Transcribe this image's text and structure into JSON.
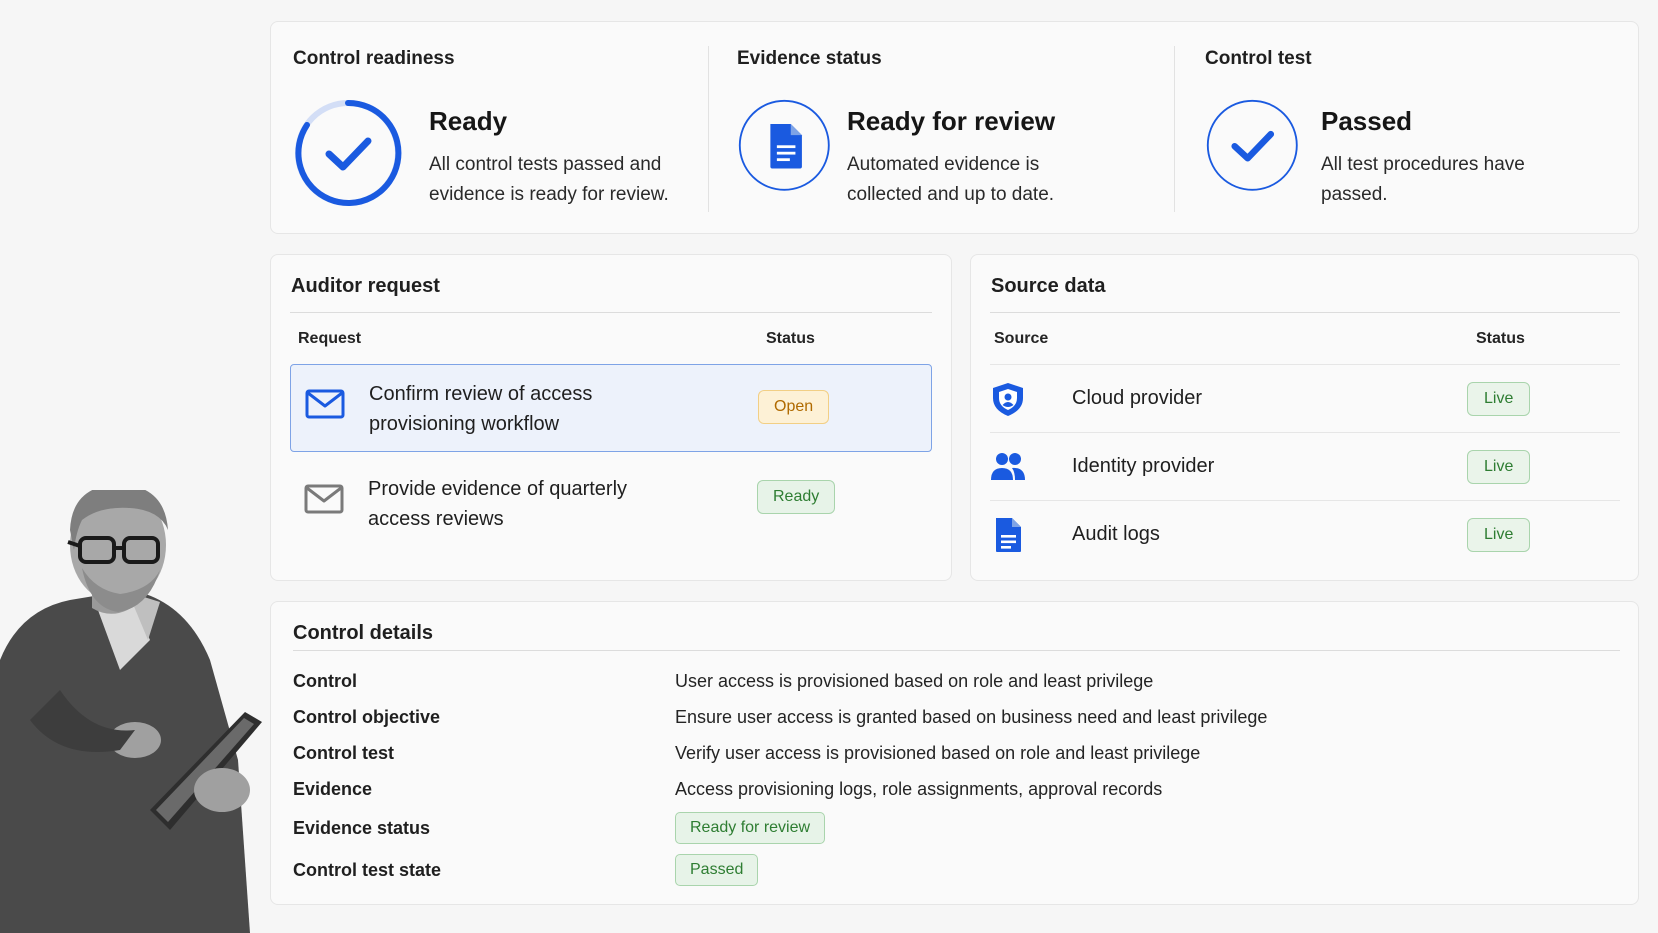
{
  "control_readiness": {
    "title": "Control readiness",
    "headline": "Ready",
    "description": "All control tests passed and evidence is ready for review.",
    "icon": "check-circle-icon"
  },
  "evidence_status": {
    "title": "Evidence status",
    "headline": "Ready for review",
    "description": "Automated evidence is collected and up to date.",
    "icon": "document-icon"
  },
  "control_test": {
    "title": "Control test",
    "headline": "Passed",
    "description": "All test procedures have passed.",
    "icon": "check-circle-icon"
  },
  "auditor_request": {
    "title": "Auditor request",
    "col_request": "Request",
    "col_status": "Status",
    "rows": [
      {
        "text": "Confirm review of access provisioning workflow",
        "status": "Open",
        "icon": "mail-icon"
      },
      {
        "text": "Provide evidence of quarterly access reviews",
        "status": "Ready",
        "icon": "mail-icon"
      }
    ]
  },
  "source_data": {
    "title": "Source data",
    "col_source": "Source",
    "col_status": "Status",
    "rows": [
      {
        "label": "Cloud provider",
        "status": "Live",
        "icon": "shield-icon"
      },
      {
        "label": "Identity provider",
        "status": "Live",
        "icon": "users-icon"
      },
      {
        "label": "Audit logs",
        "status": "Live",
        "icon": "document-icon"
      }
    ]
  },
  "control_details": {
    "title": "Control details",
    "control_label": "Control",
    "control_value": "User access is provisioned based on role and least privilege",
    "objective_label": "Control objective",
    "objective_value": "Ensure user access is granted based on business need and least privilege",
    "test_label": "Control test",
    "test_value": "Verify user access is provisioned based on role and least privilege",
    "evidence_label": "Evidence",
    "evidence_value": "Access provisioning logs, role assignments, approval records",
    "evidence_status_label": "Evidence status",
    "evidence_status_value": "Ready for review",
    "test_state_label": "Control test state",
    "test_state_value": "Passed"
  },
  "colors": {
    "accent": "#1a5ae0",
    "accent_light": "#d3def6",
    "open_text": "#b06a00",
    "ready_text": "#2e7d32"
  }
}
